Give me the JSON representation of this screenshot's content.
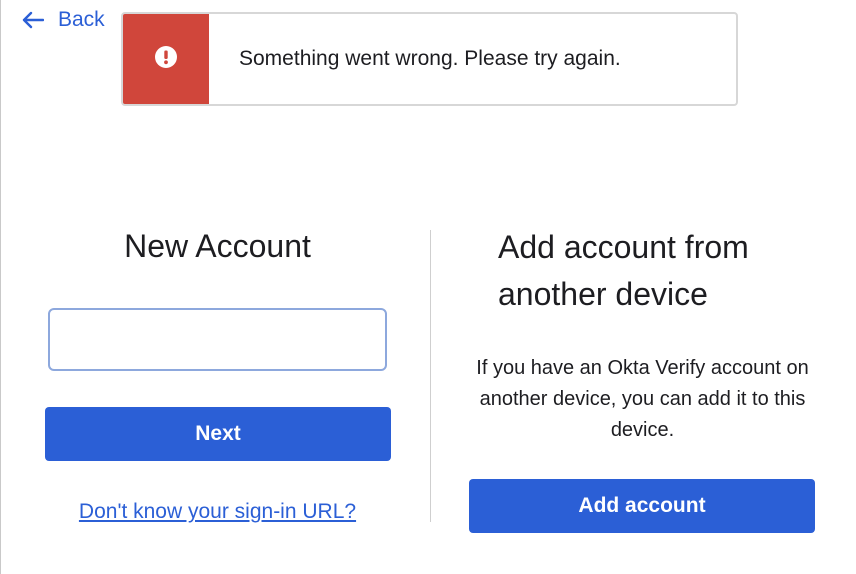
{
  "nav": {
    "back_label": "Back"
  },
  "error": {
    "message": "Something went wrong. Please try again.",
    "color": "#d0463b"
  },
  "new_account": {
    "title": "New Account",
    "input_value": "",
    "next_label": "Next",
    "help_link": "Don't know your sign-in URL?"
  },
  "add_from_device": {
    "title_line1": "Add account from",
    "title_line2": "another device",
    "description": "If you have an Okta Verify account on another device, you can add it to this device.",
    "button_label": "Add account"
  },
  "colors": {
    "accent": "#2b5fd6",
    "error": "#d0463b"
  },
  "icons": {
    "back": "arrow-left-icon",
    "error": "exclamation-circle-icon"
  }
}
